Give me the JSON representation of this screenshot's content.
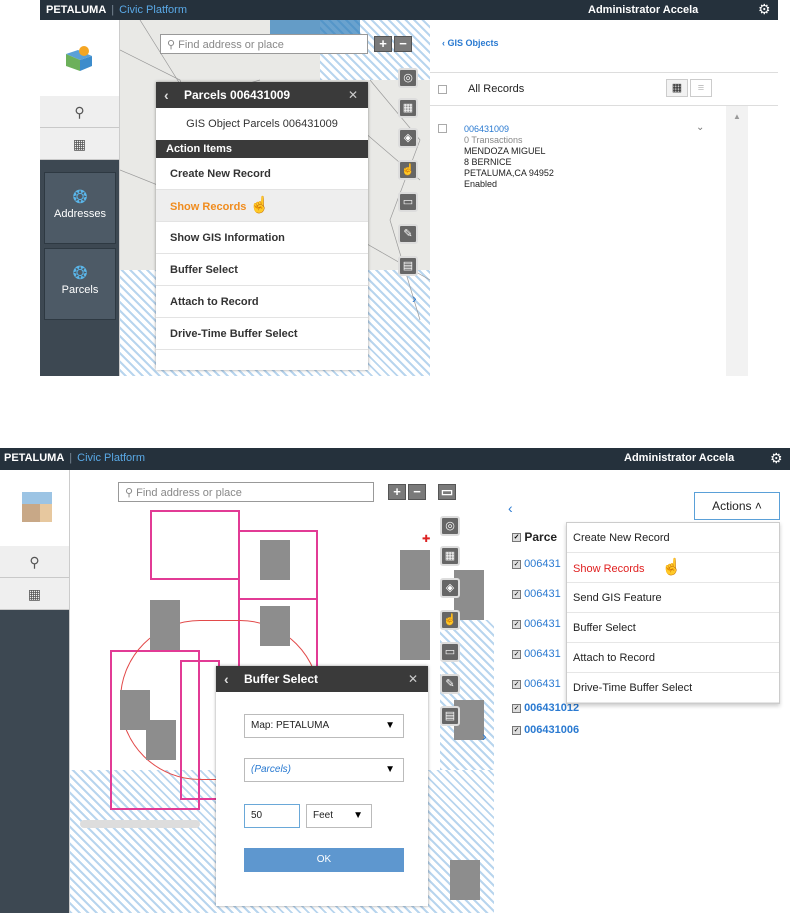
{
  "top": {
    "brand": "PETALUMA",
    "divider": "|",
    "platform": "Civic Platform",
    "user": "Administrator Accela"
  },
  "panel1": {
    "search_placeholder": "Find address or place",
    "sidebar": {
      "addresses_label": "Addresses",
      "parcels_label": "Parcels"
    },
    "popup": {
      "title": "Parcels 006431009",
      "subtitle": "GIS Object Parcels 006431009",
      "section": "Action Items",
      "items": [
        "Create New Record",
        "Show Records",
        "Show GIS Information",
        "Buffer Select",
        "Attach to Record",
        "Drive-Time Buffer Select"
      ]
    },
    "right": {
      "back_label": "GIS Objects",
      "all_records": "All Records",
      "record": {
        "id": "006431009",
        "transactions": "0 Transactions",
        "owner": "MENDOZA MIGUEL",
        "street": "8 BERNICE",
        "city": "PETALUMA,CA 94952",
        "status": "Enabled"
      }
    }
  },
  "panel2": {
    "search_placeholder": "Find address or place",
    "buffer": {
      "title": "Buffer Select",
      "map_select": "Map: PETALUMA",
      "layer_select": "(Parcels)",
      "distance": "50",
      "unit": "Feet",
      "ok": "OK"
    },
    "right": {
      "actions_label": "Actions",
      "column_header": "Parce",
      "rows": [
        "006431",
        "006431",
        "006431",
        "006431",
        "006431",
        "006431012",
        "006431006"
      ],
      "menu": [
        "Create New Record",
        "Show Records",
        "Send GIS Feature",
        "Buffer Select",
        "Attach to Record",
        "Drive-Time Buffer Select"
      ]
    }
  }
}
